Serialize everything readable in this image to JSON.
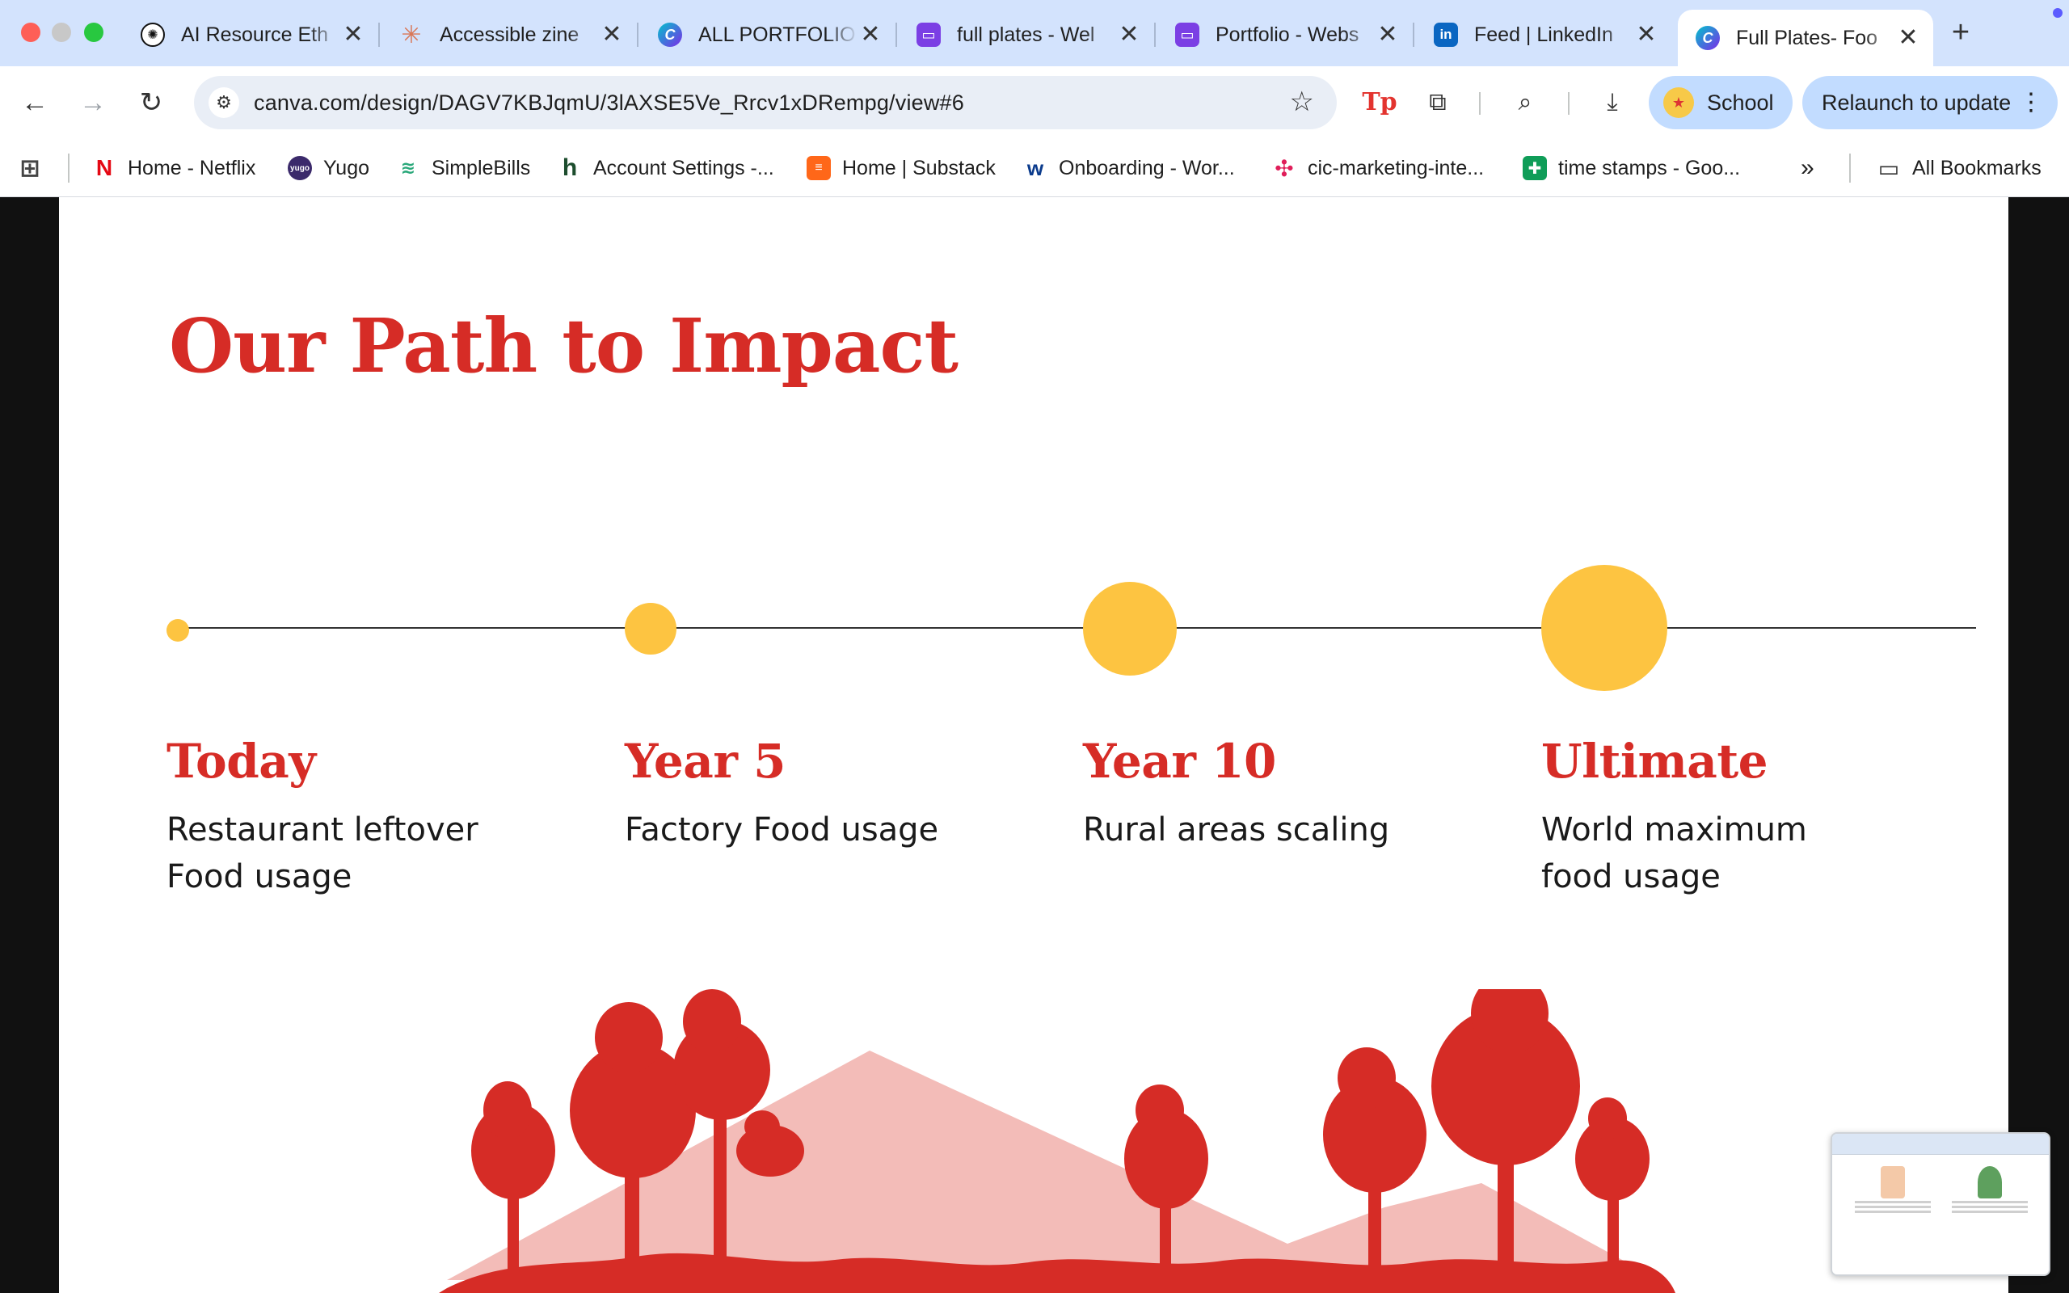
{
  "browser": {
    "tabs": [
      {
        "title": "AI Resource Eth",
        "icon": "openai-icon",
        "color": "#1f1f1f"
      },
      {
        "title": "Accessible zine",
        "icon": "claude-icon",
        "color": "#d97757"
      },
      {
        "title": "ALL PORTFOLIO",
        "icon": "canva-icon",
        "color": "#3b6ef5"
      },
      {
        "title": "full plates - Wel",
        "icon": "canva-website-icon",
        "color": "#7b3fe4"
      },
      {
        "title": "Portfolio - Webs",
        "icon": "canva-website-icon",
        "color": "#7b3fe4"
      },
      {
        "title": "Feed | LinkedIn",
        "icon": "linkedin-icon",
        "color": "#0a66c2"
      },
      {
        "title": "Full Plates- Foo",
        "icon": "canva-icon",
        "color": "#3b6ef5"
      }
    ],
    "tab_close": "✕",
    "new_tab": "+",
    "url": "canva.com/design/DAGV7KBJqmU/3lAXSE5Ve_Rrcv1xDRempg/view#6",
    "profile_label": "School",
    "relaunch_label": "Relaunch to update",
    "extension_tp": "Tp",
    "bookmarks": [
      {
        "label": "Home - Netflix",
        "icon": "netflix-icon"
      },
      {
        "label": "Yugo",
        "icon": "yugo-icon"
      },
      {
        "label": "SimpleBills",
        "icon": "simplebills-icon"
      },
      {
        "label": "Account Settings -...",
        "icon": "houzz-icon"
      },
      {
        "label": "Home | Substack",
        "icon": "substack-icon"
      },
      {
        "label": "Onboarding - Wor...",
        "icon": "workday-icon"
      },
      {
        "label": "cic-marketing-inte...",
        "icon": "slack-icon"
      },
      {
        "label": "time stamps - Goo...",
        "icon": "google-sheets-icon"
      }
    ],
    "bookmarks_overflow": "»",
    "all_bookmarks": "All Bookmarks"
  },
  "slide": {
    "title": "Our Path to Impact",
    "milestones": [
      {
        "title": "Today",
        "description": "Restaurant leftover Food usage"
      },
      {
        "title": "Year 5",
        "description": "Factory Food usage"
      },
      {
        "title": "Year 10",
        "description": "Rural areas scaling"
      },
      {
        "title": "Ultimate",
        "description": "World maximum food usage"
      }
    ],
    "colors": {
      "accent_red": "#d62c26",
      "dot_yellow": "#fdc441",
      "mountain_pink": "#f3bcb8"
    }
  }
}
